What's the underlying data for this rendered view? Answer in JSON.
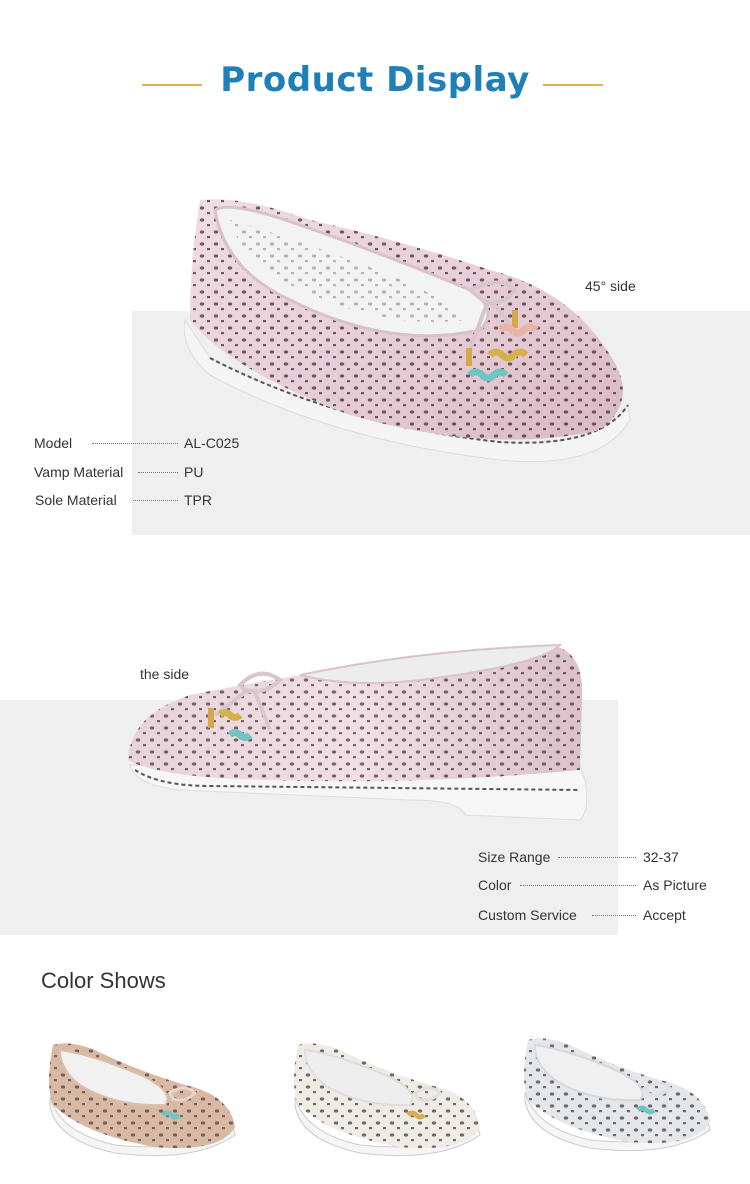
{
  "header": {
    "title": "Product Display"
  },
  "views": {
    "angle_label": "45°  side",
    "side_label": "the side"
  },
  "specs_top": [
    {
      "label": "Model",
      "value": "AL-C025"
    },
    {
      "label": "Vamp Material",
      "value": "PU"
    },
    {
      "label": "Sole Material",
      "value": "TPR"
    }
  ],
  "specs_bottom": [
    {
      "label": "Size Range",
      "value": "32-37"
    },
    {
      "label": "Color",
      "value": "As Picture"
    },
    {
      "label": "Custom Service",
      "value": "Accept"
    }
  ],
  "color_shows": {
    "title": "Color Shows",
    "variants": [
      "gold",
      "white",
      "silver"
    ]
  },
  "colors": {
    "accent_blue": "#1f7fb7",
    "accent_gold": "#d9b44a",
    "panel_grey": "#efefef"
  }
}
